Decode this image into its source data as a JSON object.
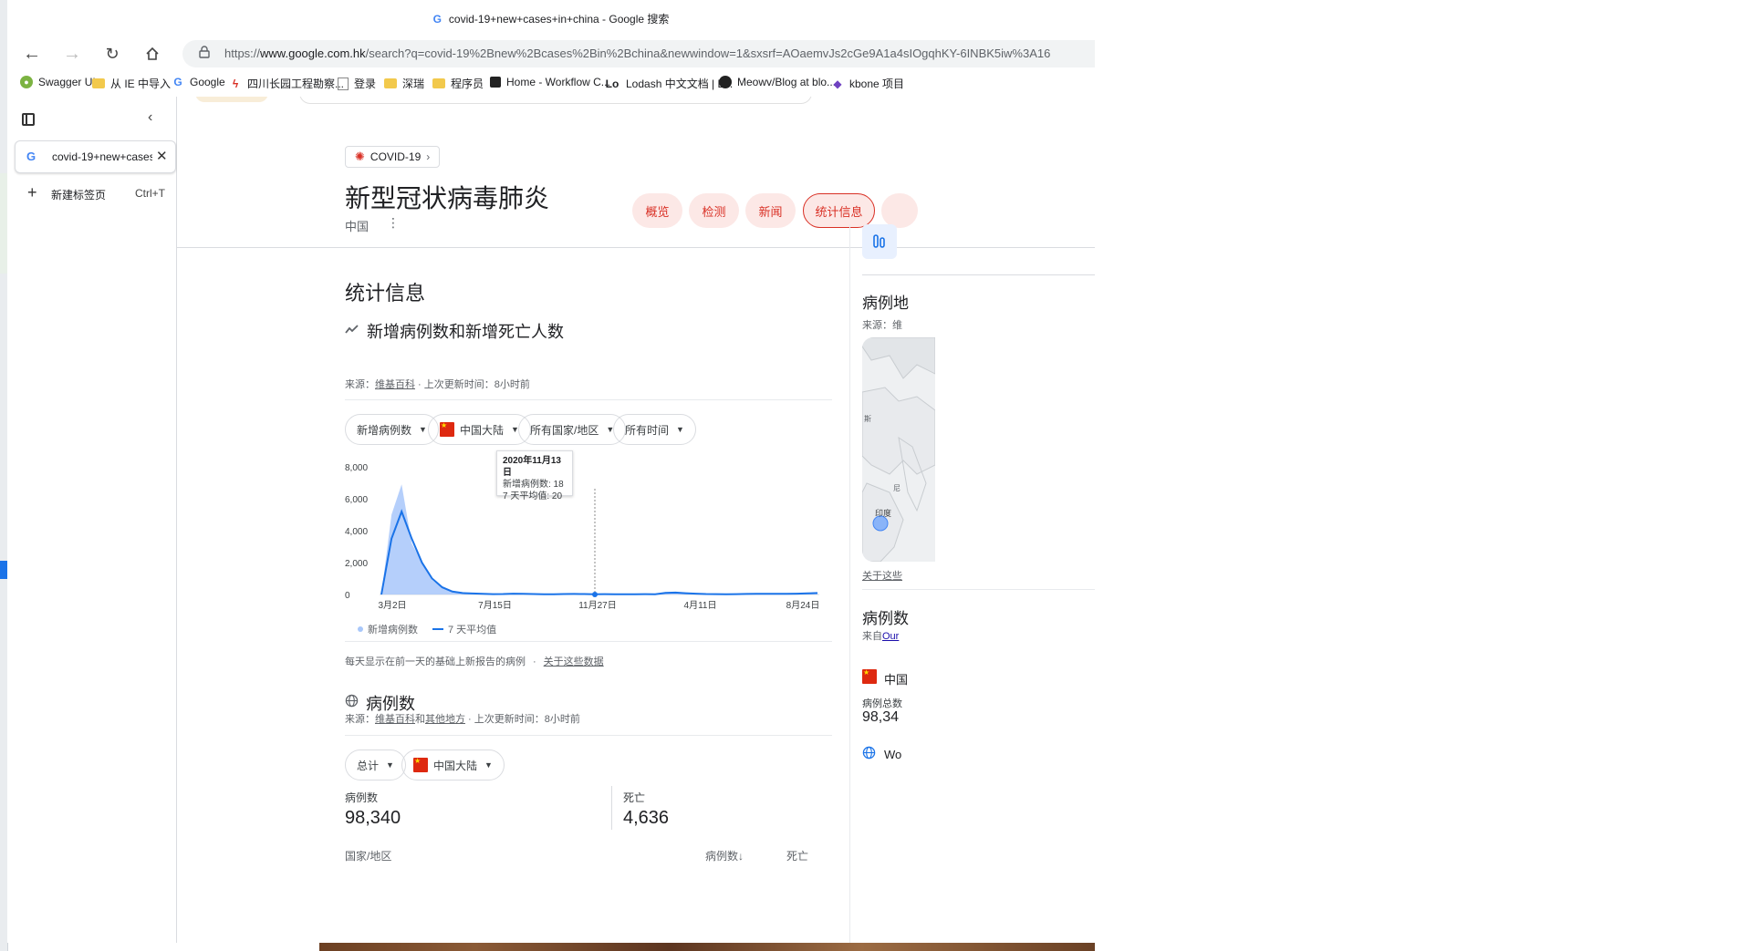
{
  "window": {
    "title": "covid-19+new+cases+in+china - Google 搜索"
  },
  "address_bar": {
    "url_prefix": "https://",
    "url_domain": "www.google.com.hk",
    "url_rest": "/search?q=covid-19%2Bnew%2Bcases%2Bin%2Bchina&newwindow=1&sxsrf=AOaemvJs2cGe9A1a4sIOgqhKY-6INBK5iw%3A16"
  },
  "bookmarks": [
    {
      "label": "Swagger UI",
      "icon": "swagger-icon"
    },
    {
      "label": "从 IE 中导入",
      "icon": "folder-icon"
    },
    {
      "label": "Google",
      "icon": "google-icon"
    },
    {
      "label": "四川长园工程勘察...",
      "icon": "lightning-icon"
    },
    {
      "label": "登录",
      "icon": "document-icon"
    },
    {
      "label": "深瑞",
      "icon": "folder-icon"
    },
    {
      "label": "程序员",
      "icon": "folder-icon"
    },
    {
      "label": "Home - Workflow C...",
      "icon": "book-icon"
    },
    {
      "label": "Lodash 中文文档 | L...",
      "icon": "lodash-icon"
    },
    {
      "label": "Meowv/Blog at blo...",
      "icon": "github-icon"
    },
    {
      "label": "kbone 项目",
      "icon": "kbone-icon"
    }
  ],
  "sidebar": {
    "active_tab_title": "covid-19+new+cases+in+china",
    "new_tab_label": "新建标签页",
    "new_tab_shortcut": "Ctrl+T"
  },
  "topic": {
    "chip": "COVID-19",
    "title": "新型冠状病毒肺炎",
    "region": "中国",
    "tabs": [
      "概览",
      "检测",
      "新闻",
      "统计信息"
    ],
    "active_tab": "统计信息"
  },
  "stats": {
    "section_title": "统计信息",
    "chart_title": "新增病例数和新增死亡人数",
    "source_prefix": "来源：",
    "source_link": "维基百科",
    "updated": " · 上次更新时间：8小时前",
    "filters": [
      "新增病例数",
      "中国大陆",
      "所有国家/地区",
      "所有时间"
    ],
    "tooltip": {
      "date": "2020年11月13日",
      "new_cases": "新增病例数: 18",
      "avg7": "7 天平均值: 20"
    },
    "legend": [
      "新增病例数",
      "7 天平均值"
    ],
    "note": "每天显示在前一天的基础上新报告的病例",
    "note_link": "关于这些数据"
  },
  "chart_data": {
    "type": "area",
    "x_ticks": [
      "3月2日",
      "7月15日",
      "11月27日",
      "4月11日",
      "8月24日"
    ],
    "y_ticks": [
      "8,000",
      "6,000",
      "4,000",
      "2,000",
      "0"
    ],
    "ylim": [
      0,
      8000
    ],
    "series": [
      {
        "name": "新增病例数",
        "values": [
          0,
          5000,
          6900,
          3200,
          2000,
          900,
          400,
          150,
          80,
          60,
          40,
          20,
          30,
          60,
          40,
          30,
          20,
          10,
          30,
          40,
          30,
          20,
          30,
          20,
          20,
          20,
          30,
          20,
          150,
          160,
          80,
          40,
          30,
          20,
          20,
          30,
          40,
          40,
          50,
          40,
          40,
          60,
          80,
          100
        ]
      },
      {
        "name": "7 天平均值",
        "values": [
          0,
          3500,
          5200,
          3500,
          2000,
          1000,
          450,
          180,
          90,
          60,
          40,
          25,
          30,
          50,
          40,
          30,
          20,
          15,
          30,
          35,
          30,
          20,
          25,
          20,
          20,
          20,
          25,
          20,
          100,
          120,
          80,
          50,
          30,
          25,
          20,
          25,
          35,
          40,
          45,
          45,
          40,
          50,
          70,
          90
        ]
      }
    ],
    "grid": true,
    "legend_position": "bottom-left"
  },
  "cases": {
    "title": "病例数",
    "source_prefix": "来源：",
    "source_link1": "维基百科",
    "source_mid": "和",
    "source_link2": "其他地方",
    "updated": " · 上次更新时间：8小时前",
    "filters": [
      "总计",
      "中国大陆"
    ],
    "cases_label": "病例数",
    "cases_value": "98,340",
    "deaths_label": "死亡",
    "deaths_value": "4,636",
    "col_country": "国家/地区",
    "col_cases": "病例数↓",
    "col_deaths": "死亡"
  },
  "right_panel": {
    "map_title": "病例地",
    "map_source": "来源：维",
    "map_labels": [
      "斯",
      "印度",
      "尼"
    ],
    "map_link": "关于这些",
    "cases_title": "病例数",
    "cases_source_prefix": "来自",
    "cases_source_link": "Our",
    "country": "中国",
    "total_label": "病例总数",
    "total_value": "98,34",
    "world": "Wo"
  }
}
